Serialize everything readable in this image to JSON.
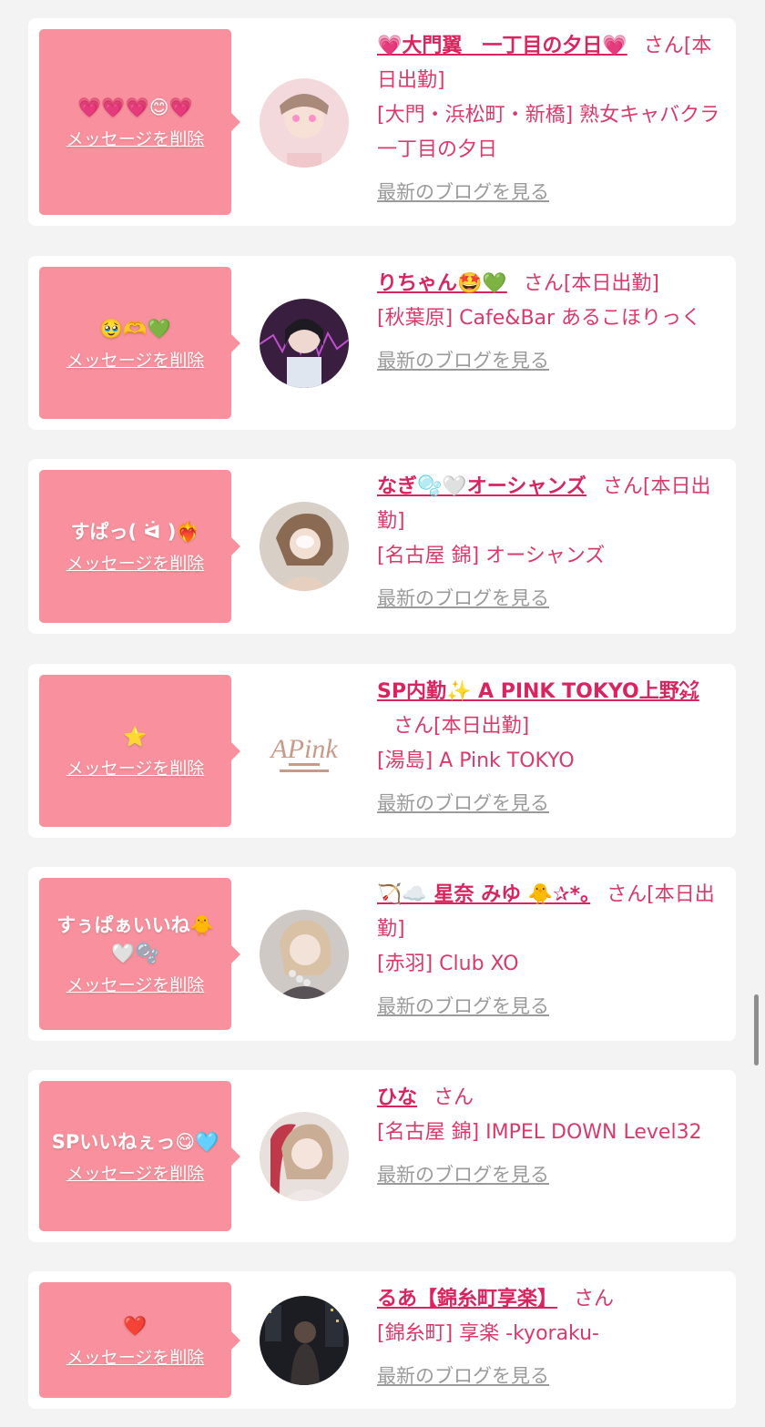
{
  "colors": {
    "background": "#f3f3f3",
    "bubble": "#f8919d",
    "name": "#d9255f",
    "text": "#d93a6a",
    "link_gray": "#9a9a9a"
  },
  "labels": {
    "delete": "メッセージを削除",
    "blog": "最新のブログを見る",
    "san": "さん"
  },
  "messages": [
    {
      "message": "💗💗💗😊💗",
      "name": "💗大門翼　一丁目の夕日💗",
      "status": "[本日出勤]",
      "shop": "[大門・浜松町・新橋] 熟女キャバクラ 一丁目の夕日",
      "avatar_icon": "profile-photo"
    },
    {
      "message": "🥹🫶💚",
      "name": "りちゃん🤩💚",
      "status": "[本日出勤]",
      "shop": "[秋葉原] Cafe&Bar あるこほりっく",
      "avatar_icon": "profile-photo"
    },
    {
      "message": "すぱっ( ᐛ )❤️‍🔥",
      "name": "なぎ🫧🤍オーシャンズ",
      "status": "[本日出勤]",
      "shop": "[名古屋 錦] オーシャンズ",
      "avatar_icon": "profile-photo"
    },
    {
      "message": "⭐",
      "name": "SP内勤✨ A PINK TOKYO上野㌶",
      "status": "[本日出勤]",
      "shop": "[湯島] A Pink TOKYO",
      "avatar_icon": "apink-logo"
    },
    {
      "message": "すぅぱぁいいね🐥🤍🫧",
      "name": "🏹☁️ 星奈 みゆ 🐥✰*｡",
      "status": "[本日出勤]",
      "shop": "[赤羽] Club XO",
      "avatar_icon": "profile-photo"
    },
    {
      "message": "SPいいねぇっ😋🩵",
      "name": "ひな",
      "status": "",
      "shop": "[名古屋 錦] IMPEL DOWN Level32",
      "avatar_icon": "profile-photo"
    },
    {
      "message": "❤️",
      "name": "るあ【錦糸町享楽】",
      "status": "",
      "shop": "[錦糸町] 享楽 -kyoraku-",
      "avatar_icon": "profile-photo"
    }
  ]
}
